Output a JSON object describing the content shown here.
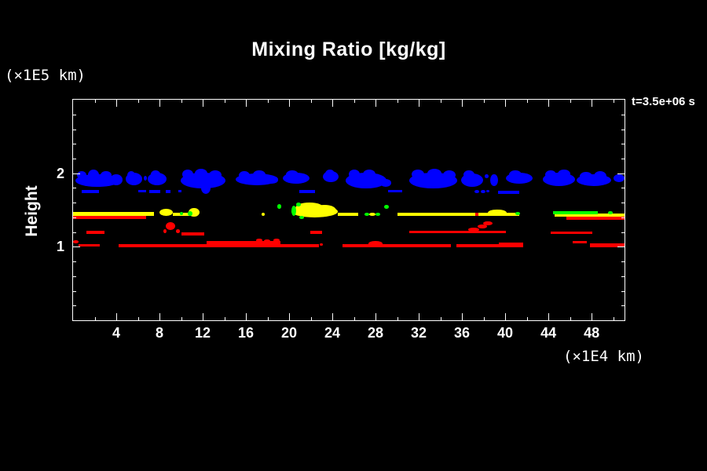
{
  "title": "Mixing Ratio [kg/kg]",
  "labels": {
    "top_left_unit": "(×1E5 km)",
    "bottom_right_unit": "(×1E4 km)",
    "time": "t=3.5e+06 s",
    "y_axis_title": "Height"
  },
  "colors": {
    "background": "#000000",
    "frame": "#ffffff",
    "text": "#ffffff",
    "cloud_blue": "#0000ff",
    "mixing_yellow": "#ffff00",
    "mixing_green": "#00ff00",
    "mixing_red": "#ff0000"
  },
  "chart_data": {
    "type": "heatmap",
    "title": "Mixing Ratio [kg/kg]",
    "xlabel": "(×1E4 km)",
    "ylabel": "Height (×1E5 km)",
    "time_annotation": "t=3.5e+06 s",
    "xlim": [
      0,
      51.05
    ],
    "ylim": [
      0,
      3.0
    ],
    "x_major_ticks": [
      4,
      8,
      12,
      16,
      20,
      24,
      28,
      32,
      36,
      40,
      44,
      48
    ],
    "x_minor_ticks": [
      2,
      6,
      10,
      14,
      18,
      22,
      26,
      30,
      34,
      38,
      42,
      46,
      50
    ],
    "y_major_ticks": [
      1,
      2
    ],
    "y_minor_ticks": [
      0.2,
      0.4,
      0.6,
      0.8,
      1.2,
      1.4,
      1.6,
      1.8,
      2.2,
      2.4,
      2.6,
      2.8
    ],
    "grid": false,
    "legend": false,
    "layers": [
      {
        "name": "cloud-band-blue",
        "color": "#0000ff",
        "shapes": [
          [
            0.22,
            4.29,
            1.81,
            1.99,
            "e"
          ],
          [
            0.36,
            1.24,
            1.92,
            2.03,
            "e"
          ],
          [
            1.38,
            2.4,
            1.9,
            2.05,
            "e"
          ],
          [
            2.54,
            3.56,
            1.92,
            2.03,
            "e"
          ],
          [
            3.42,
            4.58,
            1.84,
            1.99,
            "e"
          ],
          [
            0.8,
            2.4,
            1.73,
            1.77,
            "r"
          ],
          [
            4.87,
            6.4,
            1.84,
            2.01,
            "e"
          ],
          [
            5.02,
            5.74,
            1.92,
            2.03,
            "e"
          ],
          [
            6.54,
            6.83,
            1.9,
            1.96,
            "e"
          ],
          [
            6.91,
            8.65,
            1.84,
            2.01,
            "e"
          ],
          [
            7.2,
            8.07,
            1.93,
            2.04,
            "e"
          ],
          [
            6.03,
            6.76,
            1.74,
            1.77,
            "r"
          ],
          [
            7.05,
            8.07,
            1.73,
            1.77,
            "r"
          ],
          [
            8.58,
            9.01,
            1.73,
            1.77,
            "r"
          ],
          [
            9.96,
            14.1,
            1.79,
            2.01,
            "e"
          ],
          [
            10.1,
            11.12,
            1.92,
            2.05,
            "e"
          ],
          [
            11.27,
            12.43,
            1.93,
            2.06,
            "e"
          ],
          [
            12.58,
            13.74,
            1.91,
            2.04,
            "e"
          ],
          [
            11.85,
            12.72,
            1.72,
            1.88,
            "e"
          ],
          [
            9.74,
            10.03,
            1.74,
            1.77,
            "r"
          ],
          [
            15.05,
            18.98,
            1.84,
            2.0,
            "e"
          ],
          [
            15.34,
            16.36,
            1.91,
            2.03,
            "e"
          ],
          [
            16.65,
            17.81,
            1.92,
            2.04,
            "e"
          ],
          [
            17.81,
            18.98,
            1.86,
            1.96,
            "e"
          ],
          [
            19.41,
            21.88,
            1.86,
            2.01,
            "e"
          ],
          [
            19.7,
            20.87,
            1.92,
            2.04,
            "e"
          ],
          [
            20.94,
            22.39,
            1.73,
            1.77,
            "r"
          ],
          [
            23.12,
            24.57,
            1.88,
            2.03,
            "e"
          ],
          [
            23.34,
            24.21,
            1.93,
            2.05,
            "e"
          ],
          [
            25.23,
            29.01,
            1.79,
            2.01,
            "e"
          ],
          [
            25.52,
            26.54,
            1.92,
            2.05,
            "e"
          ],
          [
            26.83,
            27.99,
            1.92,
            2.05,
            "e"
          ],
          [
            28.43,
            29.45,
            1.82,
            1.92,
            "e"
          ],
          [
            29.16,
            30.46,
            1.74,
            1.77,
            "r"
          ],
          [
            31.12,
            35.55,
            1.79,
            2.01,
            "e"
          ],
          [
            31.34,
            32.5,
            1.92,
            2.05,
            "e"
          ],
          [
            32.79,
            34.1,
            1.93,
            2.06,
            "e"
          ],
          [
            34.24,
            35.41,
            1.91,
            2.04,
            "e"
          ],
          [
            35.92,
            37.95,
            1.82,
            2.0,
            "e"
          ],
          [
            36.13,
            37.15,
            1.92,
            2.04,
            "e"
          ],
          [
            38.1,
            38.46,
            1.93,
            1.99,
            "e"
          ],
          [
            38.6,
            39.33,
            1.82,
            1.99,
            "e"
          ],
          [
            37.15,
            37.59,
            1.73,
            1.77,
            "e"
          ],
          [
            37.73,
            38.17,
            1.73,
            1.77,
            "e"
          ],
          [
            38.24,
            38.53,
            1.74,
            1.77,
            "e"
          ],
          [
            40.06,
            42.53,
            1.86,
            2.01,
            "e"
          ],
          [
            40.35,
            41.51,
            1.92,
            2.04,
            "e"
          ],
          [
            39.33,
            41.29,
            1.72,
            1.76,
            "r"
          ],
          [
            43.47,
            46.46,
            1.83,
            2.01,
            "e"
          ],
          [
            43.69,
            44.71,
            1.92,
            2.04,
            "e"
          ],
          [
            44.86,
            46.02,
            1.93,
            2.05,
            "e"
          ],
          [
            46.6,
            49.8,
            1.83,
            1.99,
            "e"
          ],
          [
            46.89,
            48.06,
            1.9,
            2.02,
            "e"
          ],
          [
            48.2,
            49.36,
            1.89,
            2.03,
            "e"
          ],
          [
            50.02,
            51.03,
            1.88,
            1.99,
            "e"
          ]
        ]
      },
      {
        "name": "mixing-band-yellow",
        "color": "#ffff00",
        "shapes": [
          [
            0,
            7.49,
            1.42,
            1.47,
            "r"
          ],
          [
            8.0,
            9.23,
            1.42,
            1.52,
            "e"
          ],
          [
            9.23,
            10.9,
            1.42,
            1.46,
            "r"
          ],
          [
            10.69,
            11.7,
            1.41,
            1.53,
            "e"
          ],
          [
            17.45,
            17.74,
            1.42,
            1.46,
            "e"
          ],
          [
            20.21,
            24.5,
            1.4,
            1.56,
            "e"
          ],
          [
            20.58,
            23.19,
            1.45,
            1.6,
            "e"
          ],
          [
            22.18,
            24.36,
            1.42,
            1.57,
            "e"
          ],
          [
            24.5,
            26.39,
            1.42,
            1.46,
            "r"
          ],
          [
            27.41,
            27.99,
            1.42,
            1.46,
            "e"
          ],
          [
            30.03,
            41.29,
            1.42,
            1.46,
            "r"
          ],
          [
            38.39,
            40.13,
            1.42,
            1.51,
            "e"
          ],
          [
            44.57,
            51.03,
            1.41,
            1.45,
            "r"
          ]
        ]
      },
      {
        "name": "mixing-band-red",
        "color": "#ff0000",
        "shapes": [
          [
            0,
            6.76,
            1.38,
            1.42,
            "r"
          ],
          [
            37.22,
            37.52,
            1.42,
            1.46,
            "r"
          ],
          [
            45.66,
            51.03,
            1.37,
            1.41,
            "r"
          ],
          [
            1.24,
            2.91,
            1.17,
            1.22,
            "r"
          ],
          [
            8.36,
            8.65,
            1.19,
            1.24,
            "e"
          ],
          [
            8.58,
            9.45,
            1.23,
            1.34,
            "e"
          ],
          [
            9.52,
            9.89,
            1.19,
            1.24,
            "e"
          ],
          [
            10.03,
            12.14,
            1.15,
            1.2,
            "r"
          ],
          [
            21.96,
            23.05,
            1.17,
            1.22,
            "r"
          ],
          [
            31.12,
            40.06,
            1.18,
            1.22,
            "r"
          ],
          [
            36.57,
            37.59,
            1.21,
            1.26,
            "e"
          ],
          [
            37.44,
            38.31,
            1.25,
            1.3,
            "e"
          ],
          [
            37.95,
            38.82,
            1.29,
            1.35,
            "e"
          ],
          [
            44.2,
            48.06,
            1.17,
            1.21,
            "r"
          ],
          [
            0,
            0.51,
            1.05,
            1.09,
            "e"
          ],
          [
            0.51,
            2.47,
            1.0,
            1.04,
            "r"
          ],
          [
            4.22,
            22.76,
            0.99,
            1.04,
            "r"
          ],
          [
            12.36,
            19.19,
            1.03,
            1.08,
            "r"
          ],
          [
            16.94,
            17.52,
            1.07,
            1.11,
            "e"
          ],
          [
            17.67,
            18.25,
            1.06,
            1.1,
            "e"
          ],
          [
            18.54,
            19.12,
            1.07,
            1.11,
            "e"
          ],
          [
            22.83,
            23.12,
            1.01,
            1.05,
            "e"
          ],
          [
            24.94,
            34.97,
            0.99,
            1.04,
            "r"
          ],
          [
            27.34,
            28.65,
            1.0,
            1.08,
            "e"
          ],
          [
            35.48,
            41.66,
            0.99,
            1.04,
            "r"
          ],
          [
            39.4,
            41.66,
            1.0,
            1.06,
            "r"
          ],
          [
            46.24,
            47.55,
            1.04,
            1.08,
            "r"
          ],
          [
            47.84,
            51.03,
            0.99,
            1.05,
            "r"
          ]
        ]
      },
      {
        "name": "mixing-band-green",
        "color": "#00ff00",
        "shapes": [
          [
            9.89,
            10.18,
            1.43,
            1.47,
            "e"
          ],
          [
            10.61,
            11.05,
            1.42,
            1.48,
            "e"
          ],
          [
            18.9,
            19.27,
            1.52,
            1.58,
            "e"
          ],
          [
            20.21,
            20.65,
            1.42,
            1.56,
            "e"
          ],
          [
            20.65,
            21.08,
            1.55,
            1.6,
            "e"
          ],
          [
            20.94,
            21.38,
            1.38,
            1.42,
            "e"
          ],
          [
            26.97,
            27.41,
            1.42,
            1.46,
            "e"
          ],
          [
            27.99,
            28.43,
            1.42,
            1.46,
            "e"
          ],
          [
            28.79,
            29.23,
            1.51,
            1.57,
            "e"
          ],
          [
            40.93,
            41.37,
            1.43,
            1.47,
            "e"
          ],
          [
            44.42,
            48.56,
            1.44,
            1.48,
            "r"
          ],
          [
            49.51,
            49.94,
            1.44,
            1.48,
            "e"
          ]
        ]
      }
    ]
  }
}
